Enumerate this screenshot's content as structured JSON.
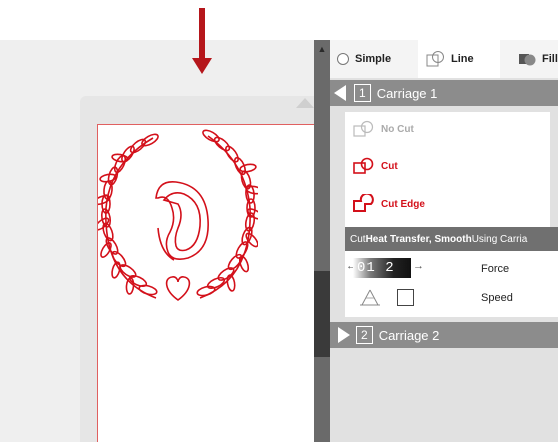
{
  "tabs": [
    {
      "label": "Simple",
      "icon": "radio-icon"
    },
    {
      "label": "Line",
      "icon": "line-icon"
    },
    {
      "label": "Fill",
      "icon": "fill-icon"
    }
  ],
  "carriage1": {
    "number": "1",
    "title": "Carriage 1"
  },
  "carriage2": {
    "number": "2",
    "title": "Carriage 2"
  },
  "cut_options": [
    {
      "label": "No Cut",
      "icon": "no-cut-icon"
    },
    {
      "label": "Cut",
      "icon": "cut-icon"
    },
    {
      "label": "Cut Edge",
      "icon": "cut-edge-icon"
    }
  ],
  "info": {
    "prefix": "Cut ",
    "material": "Heat Transfer, Smooth",
    "suffix": " Using Carria"
  },
  "settings": {
    "value_display": "01 2 34",
    "force_label": "Force",
    "speed_label": "Speed"
  },
  "colors": {
    "accent_red": "#d3101a",
    "arrow_red": "#b5161b",
    "header_gray": "#8c8c8c"
  }
}
